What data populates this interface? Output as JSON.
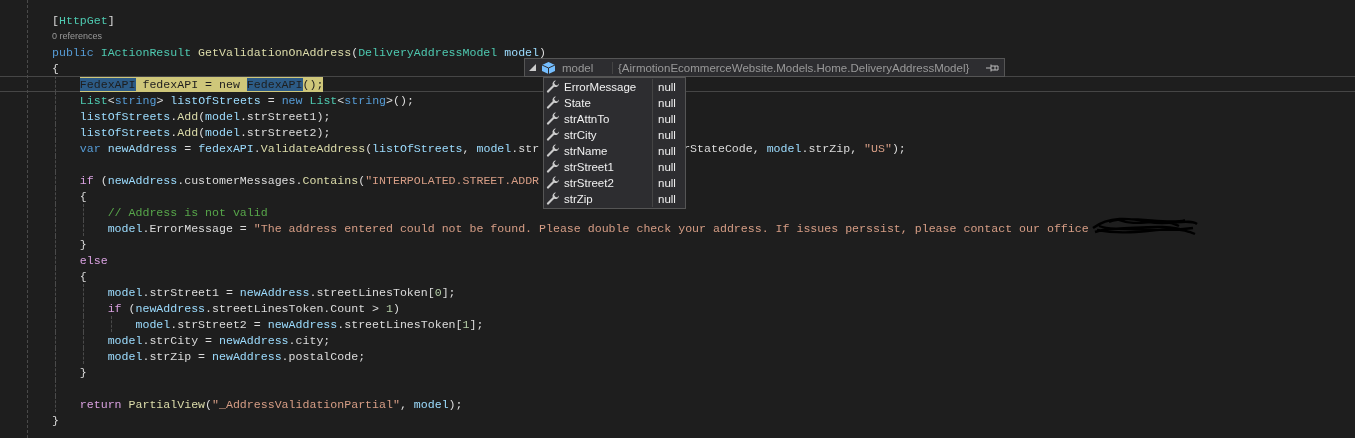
{
  "lines": [
    {
      "kind": "code",
      "current": false,
      "tokens": [
        {
          "text": "[",
          "kind": "punc"
        },
        {
          "text": "HttpGet",
          "kind": "type"
        },
        {
          "text": "]",
          "kind": "punc"
        }
      ]
    },
    {
      "kind": "codelens",
      "text": "0 references"
    },
    {
      "kind": "code",
      "current": false,
      "tokens": [
        {
          "text": "public ",
          "kind": "kw"
        },
        {
          "text": "IActionResult ",
          "kind": "type"
        },
        {
          "text": "GetValidationOnAddress",
          "kind": "method"
        },
        {
          "text": "(",
          "kind": "punc"
        },
        {
          "text": "DeliveryAddressModel ",
          "kind": "type"
        },
        {
          "text": "model",
          "kind": "var"
        },
        {
          "text": ")",
          "kind": "punc"
        }
      ]
    },
    {
      "kind": "code",
      "current": false,
      "tokens": [
        {
          "text": "{",
          "kind": "punc"
        }
      ],
      "children": [
        {
          "kind": "code",
          "current": true,
          "tokens": [
            {
              "text": "FedexAPI",
              "kind": "ref"
            },
            {
              "text": " fedexAPI = new ",
              "kind": "var"
            },
            {
              "text": "FedexAPI",
              "kind": "ref"
            },
            {
              "text": "();",
              "kind": "punc"
            }
          ]
        },
        {
          "kind": "code",
          "current": false,
          "tokens": [
            {
              "text": "List",
              "kind": "type"
            },
            {
              "text": "<",
              "kind": "punc"
            },
            {
              "text": "string",
              "kind": "kw"
            },
            {
              "text": "> ",
              "kind": "punc"
            },
            {
              "text": "listOfStreets",
              "kind": "var"
            },
            {
              "text": " = ",
              "kind": "punc"
            },
            {
              "text": "new ",
              "kind": "kw"
            },
            {
              "text": "List",
              "kind": "type"
            },
            {
              "text": "<",
              "kind": "punc"
            },
            {
              "text": "string",
              "kind": "kw"
            },
            {
              "text": ">();",
              "kind": "punc"
            }
          ]
        },
        {
          "kind": "code",
          "current": false,
          "tokens": [
            {
              "text": "listOfStreets",
              "kind": "var"
            },
            {
              "text": ".",
              "kind": "punc"
            },
            {
              "text": "Add",
              "kind": "method"
            },
            {
              "text": "(",
              "kind": "punc"
            },
            {
              "text": "model",
              "kind": "var"
            },
            {
              "text": ".strStreet1);",
              "kind": "punc"
            }
          ]
        },
        {
          "kind": "code",
          "current": false,
          "tokens": [
            {
              "text": "listOfStreets",
              "kind": "var"
            },
            {
              "text": ".",
              "kind": "punc"
            },
            {
              "text": "Add",
              "kind": "method"
            },
            {
              "text": "(",
              "kind": "punc"
            },
            {
              "text": "model",
              "kind": "var"
            },
            {
              "text": ".strStreet2);",
              "kind": "punc"
            }
          ]
        },
        {
          "kind": "code",
          "current": false,
          "tokens": [
            {
              "text": "var ",
              "kind": "kw"
            },
            {
              "text": "newAddress",
              "kind": "var"
            },
            {
              "text": " = ",
              "kind": "punc"
            },
            {
              "text": "fedexAPI",
              "kind": "var"
            },
            {
              "text": ".",
              "kind": "punc"
            },
            {
              "text": "ValidateAddress",
              "kind": "method"
            },
            {
              "text": "(",
              "kind": "punc"
            },
            {
              "text": "listOfStreets",
              "kind": "var"
            },
            {
              "text": ", ",
              "kind": "punc"
            },
            {
              "text": "model",
              "kind": "var"
            },
            {
              "text": ".str",
              "kind": "punc"
            }
          ],
          "tokens_after_popup": [
            {
              "text": "rStateCode, ",
              "kind": "punc"
            },
            {
              "text": "model",
              "kind": "var"
            },
            {
              "text": ".strZip, ",
              "kind": "punc"
            },
            {
              "text": "\"US\"",
              "kind": "str"
            },
            {
              "text": ");",
              "kind": "punc"
            }
          ]
        },
        {
          "kind": "blank"
        },
        {
          "kind": "code",
          "current": false,
          "tokens": [
            {
              "text": "if",
              "kind": "ctl"
            },
            {
              "text": " (",
              "kind": "punc"
            },
            {
              "text": "newAddress",
              "kind": "var"
            },
            {
              "text": ".customerMessages.",
              "kind": "punc"
            },
            {
              "text": "Contains",
              "kind": "method"
            },
            {
              "text": "(",
              "kind": "punc"
            },
            {
              "text": "\"INTERPOLATED.STREET.ADDR",
              "kind": "str"
            }
          ]
        },
        {
          "kind": "code",
          "current": false,
          "tokens": [
            {
              "text": "{",
              "kind": "punc"
            }
          ],
          "children": [
            {
              "kind": "code",
              "current": false,
              "tokens": [
                {
                  "text": "// Address is not valid",
                  "kind": "com"
                }
              ]
            },
            {
              "kind": "code",
              "current": false,
              "tokens": [
                {
                  "text": "model",
                  "kind": "var"
                },
                {
                  "text": ".ErrorMessage = ",
                  "kind": "punc"
                },
                {
                  "text": "\"The address entered could not be found. Please double check your address. If issues perssist, please contact our office",
                  "kind": "str"
                },
                {
                  "kind": "redacted"
                }
              ]
            }
          ]
        },
        {
          "kind": "code",
          "current": false,
          "tokens": [
            {
              "text": "}",
              "kind": "punc"
            }
          ]
        },
        {
          "kind": "code",
          "current": false,
          "tokens": [
            {
              "text": "else",
              "kind": "ctl"
            }
          ]
        },
        {
          "kind": "code",
          "current": false,
          "tokens": [
            {
              "text": "{",
              "kind": "punc"
            }
          ],
          "children": [
            {
              "kind": "code",
              "current": false,
              "tokens": [
                {
                  "text": "model",
                  "kind": "var"
                },
                {
                  "text": ".strStreet1 = ",
                  "kind": "punc"
                },
                {
                  "text": "newAddress",
                  "kind": "var"
                },
                {
                  "text": ".streetLinesToken[",
                  "kind": "punc"
                },
                {
                  "text": "0",
                  "kind": "num"
                },
                {
                  "text": "];",
                  "kind": "punc"
                }
              ]
            },
            {
              "kind": "code",
              "current": false,
              "tokens": [
                {
                  "text": "if",
                  "kind": "ctl"
                },
                {
                  "text": " (",
                  "kind": "punc"
                },
                {
                  "text": "newAddress",
                  "kind": "var"
                },
                {
                  "text": ".streetLinesToken.Count > ",
                  "kind": "punc"
                },
                {
                  "text": "1",
                  "kind": "num"
                },
                {
                  "text": ")",
                  "kind": "punc"
                }
              ],
              "children": [
                {
                  "kind": "code",
                  "current": false,
                  "tokens": [
                    {
                      "text": "model",
                      "kind": "var"
                    },
                    {
                      "text": ".strStreet2 = ",
                      "kind": "punc"
                    },
                    {
                      "text": "newAddress",
                      "kind": "var"
                    },
                    {
                      "text": ".streetLinesToken[",
                      "kind": "punc"
                    },
                    {
                      "text": "1",
                      "kind": "num"
                    },
                    {
                      "text": "];",
                      "kind": "punc"
                    }
                  ]
                }
              ]
            },
            {
              "kind": "code",
              "current": false,
              "tokens": [
                {
                  "text": "model",
                  "kind": "var"
                },
                {
                  "text": ".strCity = ",
                  "kind": "punc"
                },
                {
                  "text": "newAddress",
                  "kind": "var"
                },
                {
                  "text": ".city;",
                  "kind": "punc"
                }
              ]
            },
            {
              "kind": "code",
              "current": false,
              "tokens": [
                {
                  "text": "model",
                  "kind": "var"
                },
                {
                  "text": ".strZip = ",
                  "kind": "punc"
                },
                {
                  "text": "newAddress",
                  "kind": "var"
                },
                {
                  "text": ".postalCode;",
                  "kind": "punc"
                }
              ]
            }
          ]
        },
        {
          "kind": "code",
          "current": false,
          "tokens": [
            {
              "text": "}",
              "kind": "punc"
            }
          ]
        },
        {
          "kind": "blank"
        },
        {
          "kind": "code",
          "current": false,
          "tokens": [
            {
              "text": "return ",
              "kind": "ctl"
            },
            {
              "text": "PartialView",
              "kind": "method"
            },
            {
              "text": "(",
              "kind": "punc"
            },
            {
              "text": "\"_AddressValidationPartial\"",
              "kind": "str"
            },
            {
              "text": ", ",
              "kind": "punc"
            },
            {
              "text": "model",
              "kind": "var"
            },
            {
              "text": ");",
              "kind": "punc"
            }
          ]
        }
      ]
    },
    {
      "kind": "code",
      "current": false,
      "tokens": [
        {
          "text": "}",
          "kind": "punc"
        }
      ]
    }
  ],
  "datatip": {
    "name": "model",
    "value": "{AirmotionEcommerceWebsite.Models.Home.DeliveryAddressModel}",
    "expanded": true,
    "members": [
      {
        "name": "ErrorMessage",
        "value": "null"
      },
      {
        "name": "State",
        "value": "null"
      },
      {
        "name": "strAttnTo",
        "value": "null"
      },
      {
        "name": "strCity",
        "value": "null"
      },
      {
        "name": "strName",
        "value": "null"
      },
      {
        "name": "strStreet1",
        "value": "null"
      },
      {
        "name": "strStreet2",
        "value": "null"
      },
      {
        "name": "strZip",
        "value": "null"
      }
    ]
  }
}
